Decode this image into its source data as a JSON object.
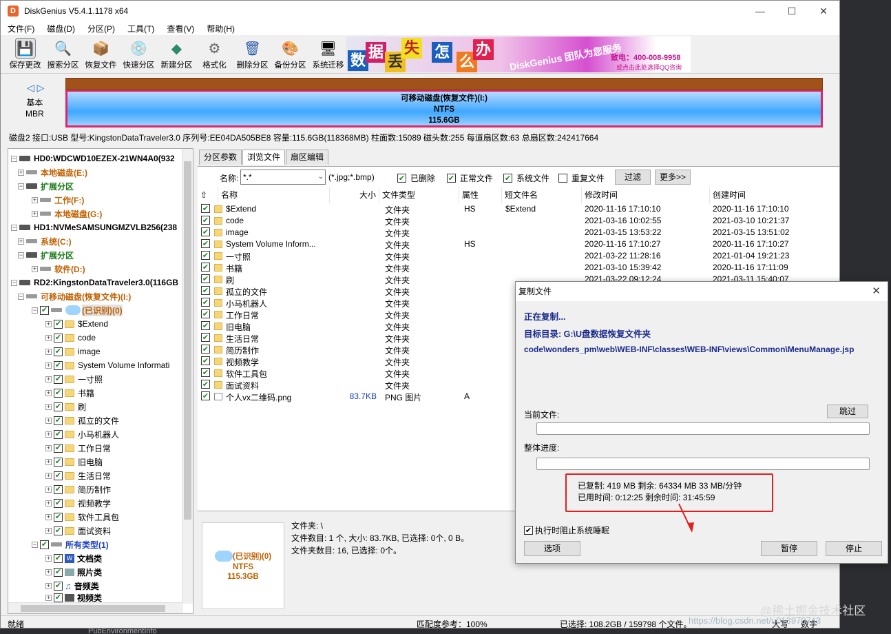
{
  "window": {
    "title": "DiskGenius V5.4.1.1178 x64",
    "controls": {
      "minimize": "—",
      "maximize": "☐",
      "close": "✕"
    }
  },
  "menu": [
    "文件(F)",
    "磁盘(D)",
    "分区(P)",
    "工具(T)",
    "查看(V)",
    "帮助(H)"
  ],
  "toolbar": [
    {
      "label": "保存更改",
      "icon": "save-icon",
      "color": "#5a6a7a"
    },
    {
      "label": "搜索分区",
      "icon": "search-icon",
      "color": "#b04020"
    },
    {
      "label": "恢复文件",
      "icon": "recover-icon",
      "color": "#6a8a2a"
    },
    {
      "label": "快速分区",
      "icon": "quick-partition-icon",
      "color": "#8a8a8a"
    },
    {
      "label": "新建分区",
      "icon": "new-partition-icon",
      "color": "#2a8a6a"
    },
    {
      "label": "格式化",
      "icon": "format-icon",
      "color": "#6a6a6a"
    },
    {
      "label": "删除分区",
      "icon": "delete-partition-icon",
      "color": "#2a5aaa"
    },
    {
      "label": "备份分区",
      "icon": "backup-icon",
      "color": "#c04a8a"
    },
    {
      "label": "系统迁移",
      "icon": "migrate-icon",
      "color": "#2a7acc"
    }
  ],
  "banner": {
    "chars": [
      "数",
      "据",
      "丢",
      "失",
      "怎",
      "么",
      "办"
    ],
    "slogan": "DiskGenius 团队为您服务",
    "phone": "致电：400-008-9958",
    "qq": "或点击此处选择QQ咨询"
  },
  "disk_view": {
    "nav": "◁ ▷",
    "type_line1": "基本",
    "type_line2": "MBR",
    "partition_name": "可移动磁盘(恢复文件)(I:)",
    "partition_fs": "NTFS",
    "partition_size": "115.6GB"
  },
  "disk_info": "磁盘2 接口:USB  型号:KingstonDataTraveler3.0  序列号:EE04DA505BE8  容量:115.6GB(118368MB)  柱面数:15089  磁头数:255  每道扇区数:63  总扇区数:242417664",
  "tree": {
    "hd0": "HD0:WDCWD10EZEX-21WN4A0(932",
    "hd0_local": "本地磁盘(E:)",
    "hd0_ext": "扩展分区",
    "hd0_work": "工作(F:)",
    "hd0_local2": "本地磁盘(G:)",
    "hd1": "HD1:NVMeSAMSUNGMZVLB256(238",
    "hd1_sys": "系统(C:)",
    "hd1_ext": "扩展分区",
    "hd1_soft": "软件(D:)",
    "rd2": "RD2:KingstonDataTraveler3.0(116GB",
    "rd2_part": "可移动磁盘(恢复文件)(I:)",
    "rd2_recognized": "(已识别)(0)",
    "folders": [
      "$Extend",
      "code",
      "image",
      "System Volume Informati",
      "一寸照",
      "书籍",
      "刷",
      "孤立的文件",
      "小马机器人",
      "工作日常",
      "旧电脑",
      "生活日常",
      "简历制作",
      "视频教学",
      "软件工具包",
      "面试资料"
    ],
    "all_types": "所有类型(1)",
    "types": [
      "文档类",
      "照片类",
      "音频类",
      "视频类"
    ]
  },
  "tabs": [
    "分区参数",
    "浏览文件",
    "扇区编辑"
  ],
  "filter": {
    "name_label": "名称:",
    "name_value": "*.*",
    "hint": "(*.jpg;*.bmp)",
    "deleted": "已删除",
    "normal": "正常文件",
    "system": "系统文件",
    "duplicate": "重复文件",
    "filter_btn": "过滤",
    "more_btn": "更多>>"
  },
  "columns": [
    "名称",
    "大小",
    "文件类型",
    "属性",
    "短文件名",
    "修改时间",
    "创建时间"
  ],
  "files": [
    {
      "name": "$Extend",
      "size": "",
      "type": "文件夹",
      "attr": "HS",
      "short": "$Extend",
      "mtime": "2020-11-16 17:10:10",
      "ctime": "2020-11-16 17:10:10"
    },
    {
      "name": "code",
      "size": "",
      "type": "文件夹",
      "attr": "",
      "short": "",
      "mtime": "2021-03-16 10:02:55",
      "ctime": "2021-03-10 10:21:37"
    },
    {
      "name": "image",
      "size": "",
      "type": "文件夹",
      "attr": "",
      "short": "",
      "mtime": "2021-03-15 13:53:22",
      "ctime": "2021-03-15 13:51:02"
    },
    {
      "name": "System Volume Inform...",
      "size": "",
      "type": "文件夹",
      "attr": "HS",
      "short": "",
      "mtime": "2020-11-16 17:10:27",
      "ctime": "2020-11-16 17:10:27"
    },
    {
      "name": "一寸照",
      "size": "",
      "type": "文件夹",
      "attr": "",
      "short": "",
      "mtime": "2021-03-22 11:28:16",
      "ctime": "2021-01-04 19:21:23"
    },
    {
      "name": "书籍",
      "size": "",
      "type": "文件夹",
      "attr": "",
      "short": "",
      "mtime": "2021-03-10 15:39:42",
      "ctime": "2020-11-16 17:11:09"
    },
    {
      "name": "刷",
      "size": "",
      "type": "文件夹",
      "attr": "",
      "short": "",
      "mtime": "2021-03-22 09:12:24",
      "ctime": "2021-03-11 15:40:07"
    },
    {
      "name": "孤立的文件",
      "size": "",
      "type": "文件夹",
      "attr": "",
      "short": "",
      "mtime": "",
      "ctime": ""
    },
    {
      "name": "小马机器人",
      "size": "",
      "type": "文件夹",
      "attr": "",
      "short": "",
      "mtime": "",
      "ctime": ""
    },
    {
      "name": "工作日常",
      "size": "",
      "type": "文件夹",
      "attr": "",
      "short": "",
      "mtime": "",
      "ctime": ""
    },
    {
      "name": "旧电脑",
      "size": "",
      "type": "文件夹",
      "attr": "",
      "short": "",
      "mtime": "",
      "ctime": ""
    },
    {
      "name": "生活日常",
      "size": "",
      "type": "文件夹",
      "attr": "",
      "short": "",
      "mtime": "",
      "ctime": ""
    },
    {
      "name": "简历制作",
      "size": "",
      "type": "文件夹",
      "attr": "",
      "short": "",
      "mtime": "",
      "ctime": ""
    },
    {
      "name": "视频教学",
      "size": "",
      "type": "文件夹",
      "attr": "",
      "short": "",
      "mtime": "",
      "ctime": ""
    },
    {
      "name": "软件工具包",
      "size": "",
      "type": "文件夹",
      "attr": "",
      "short": "",
      "mtime": "",
      "ctime": ""
    },
    {
      "name": "面试资料",
      "size": "",
      "type": "文件夹",
      "attr": "",
      "short": "",
      "mtime": "",
      "ctime": ""
    },
    {
      "name": "个人vx二维码.png",
      "size": "83.7KB",
      "type": "PNG 图片",
      "attr": "A",
      "short": "",
      "mtime": "",
      "ctime": ""
    }
  ],
  "info": {
    "box_name": "(已识别)(0)",
    "box_fs": "NTFS",
    "box_size": "115.3GB",
    "folder": "文件夹: \\",
    "line2": "文件数目: 1 个, 大小: 83.7KB, 已选择: 0个, 0 B。",
    "line3": "文件夹数目: 16, 已选择: 0个。"
  },
  "dialog": {
    "title": "复制文件",
    "copying": "正在复制...",
    "target": "目标目录:  G:\\U盘数据恢复文件夹",
    "path": "code\\wonders_pm\\web\\WEB-INF\\classes\\WEB-INF\\views\\Common\\MenuManage.jsp",
    "current_file": "当前文件:",
    "skip": "跳过",
    "overall": "整体进度:",
    "copied": "已复制:    419 MB   剩余:  64334 MB   33 MB/分钟",
    "time": "已用时间:  0:12:25   剩余时间: 31:45:59",
    "prevent_sleep": "执行时阻止系统睡眠",
    "options": "选项",
    "pause": "暂停",
    "stop": "停止"
  },
  "status": {
    "ready": "就绪",
    "match": "匹配度参考：100%",
    "selected": "已选择: 108.2GB / 159798 个文件。",
    "caps": "大写",
    "num": "数字"
  },
  "background_text": "PubEnvironmentInfo",
  "watermark": "@稀土掘金技术社区",
  "watermark2": "https://blog.csdn.net/u013970743"
}
